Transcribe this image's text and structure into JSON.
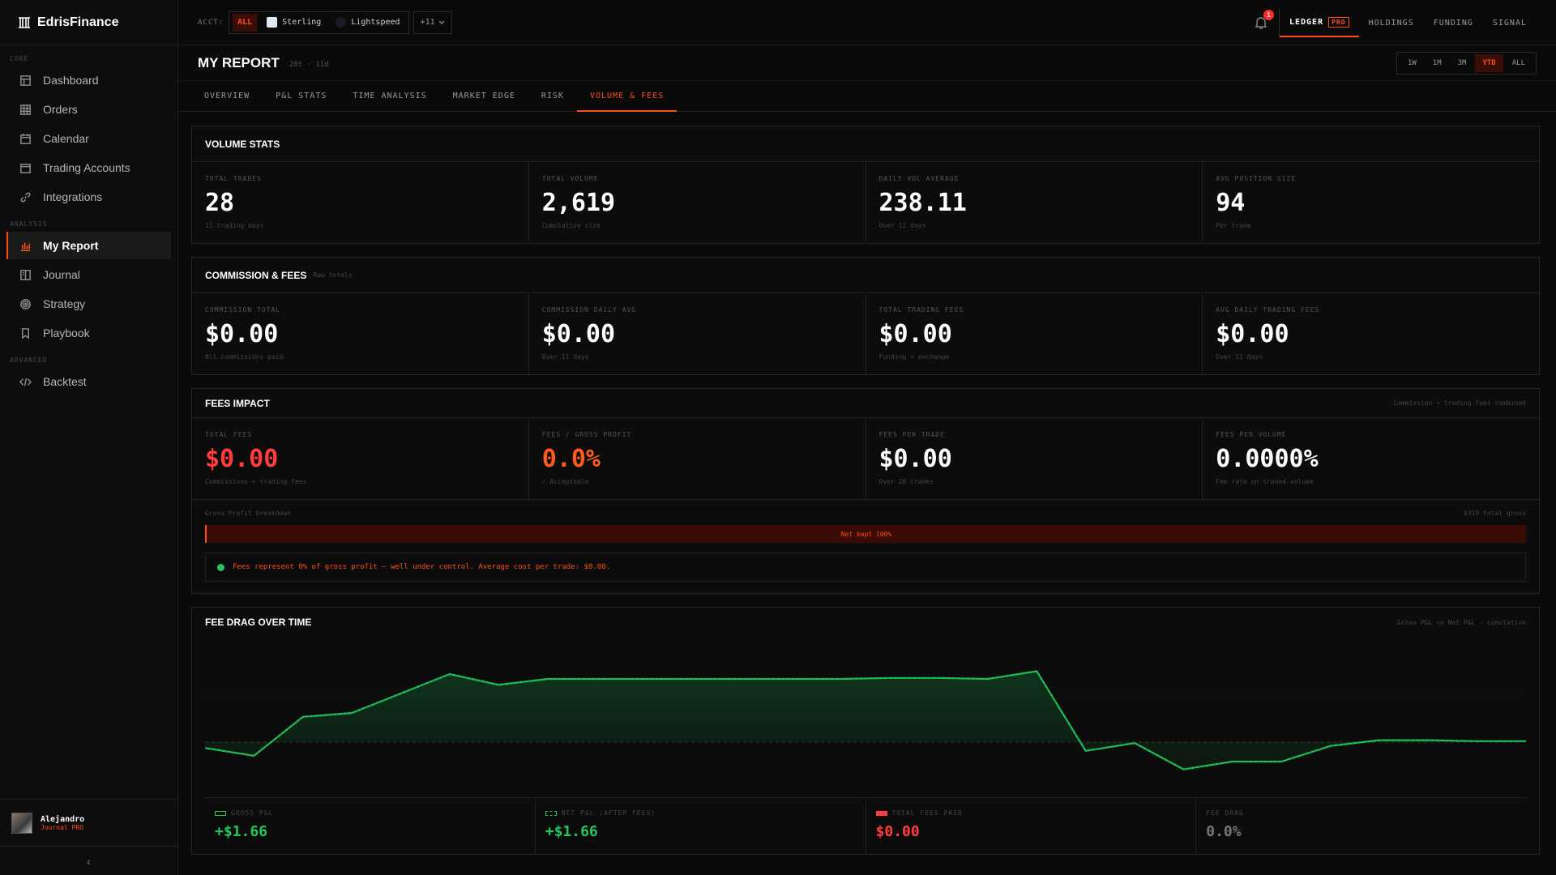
{
  "brand": {
    "name": "EdrisFinance"
  },
  "sidebar": {
    "sections": {
      "core": "CORE",
      "analysis": "ANALYSIS",
      "advanced": "ADVANCED"
    },
    "items": [
      {
        "label": "Dashboard",
        "icon": "layout-icon"
      },
      {
        "label": "Orders",
        "icon": "grid-icon"
      },
      {
        "label": "Calendar",
        "icon": "calendar-icon"
      },
      {
        "label": "Trading Accounts",
        "icon": "wallet-icon"
      },
      {
        "label": "Integrations",
        "icon": "link-icon"
      },
      {
        "label": "My Report",
        "icon": "bar-chart-icon"
      },
      {
        "label": "Journal",
        "icon": "book-icon"
      },
      {
        "label": "Strategy",
        "icon": "target-icon"
      },
      {
        "label": "Playbook",
        "icon": "bookmark-icon"
      },
      {
        "label": "Backtest",
        "icon": "code-icon"
      }
    ],
    "user": {
      "name": "Alejandro",
      "plan": "Journal PRO"
    },
    "collapse": "‹"
  },
  "topbar": {
    "acct_label": "ACCT:",
    "accounts": [
      "ALL",
      "Sterling",
      "Lightspeed"
    ],
    "more": "+11",
    "notifications": "1",
    "tabs": [
      "LEDGER",
      "HOLDINGS",
      "FUNDING",
      "SIGNAL"
    ],
    "pro": "PRO"
  },
  "header": {
    "title": "MY REPORT",
    "meta": "28t · 11d",
    "ranges": [
      "1W",
      "1M",
      "3M",
      "YTD",
      "ALL"
    ]
  },
  "tabs": [
    "OVERVIEW",
    "P&L STATS",
    "TIME ANALYSIS",
    "MARKET EDGE",
    "RISK",
    "VOLUME & FEES"
  ],
  "volume": {
    "title": "VOLUME STATS",
    "stats": [
      {
        "label": "TOTAL TRADES",
        "value": "28",
        "note": "11 trading days"
      },
      {
        "label": "TOTAL VOLUME",
        "value": "2,619",
        "note": "Cumulative size"
      },
      {
        "label": "DAILY VOL AVERAGE",
        "value": "238.11",
        "note": "Over 11 days"
      },
      {
        "label": "AVG POSITION SIZE",
        "value": "94",
        "note": "Per trade"
      }
    ]
  },
  "commission": {
    "title": "COMMISSION & FEES",
    "sub": "Raw totals",
    "stats": [
      {
        "label": "COMMISSION TOTAL",
        "value": "$0.00",
        "note": "All commissions paid"
      },
      {
        "label": "COMMISSION DAILY AVG",
        "value": "$0.00",
        "note": "Over 11 days"
      },
      {
        "label": "TOTAL TRADING FEES",
        "value": "$0.00",
        "note": "Funding + exchange"
      },
      {
        "label": "AVG DAILY TRADING FEES",
        "value": "$0.00",
        "note": "Over 11 days"
      }
    ]
  },
  "impact": {
    "title": "FEES IMPACT",
    "right": "Commission + trading fees combined",
    "stats": [
      {
        "label": "TOTAL FEES",
        "value": "$0.00",
        "note": "Commissions + trading fees"
      },
      {
        "label": "FEES / GROSS PROFIT",
        "value": "0.0%",
        "note": "✓ Acceptable"
      },
      {
        "label": "FEES PER TRADE",
        "value": "$0.00",
        "note": "Over 28 trades"
      },
      {
        "label": "FEES PER VOLUME",
        "value": "0.0000%",
        "note": "Fee rate on traded volume"
      }
    ],
    "breakdown_label": "Gross Profit breakdown",
    "breakdown_total": "$319 total gross",
    "bar_label": "Net kept 100%",
    "net_kept_fraction": 1.0,
    "note": "Fees represent 0% of gross profit — well under control. Average cost per trade: $0.00."
  },
  "drag": {
    "title": "FEE DRAG OVER TIME",
    "right": "Gross P&L vs Net P&L · cumulative",
    "legend": [
      {
        "label": "GROSS P&L",
        "value": "+$1.66"
      },
      {
        "label": "NET P&L (AFTER FEES)",
        "value": "+$1.66"
      },
      {
        "label": "TOTAL FEES PAID",
        "value": "$0.00"
      },
      {
        "label": "FEE DRAG",
        "value": "0.0%"
      }
    ]
  },
  "colors": {
    "accent": "#ff4d1a",
    "positive": "#22c55e",
    "negative": "#ff3b3b"
  },
  "chart_data": {
    "type": "area",
    "title": "FEE DRAG OVER TIME",
    "series": [
      {
        "name": "Gross P&L",
        "values": [
          -0.6,
          -1.4,
          2.6,
          3.0,
          5.0,
          7.0,
          5.9,
          6.5,
          6.5,
          6.5,
          6.5,
          6.5,
          6.5,
          6.5,
          6.6,
          6.6,
          6.5,
          7.3,
          -0.9,
          -0.1,
          -2.8,
          -2.0,
          -2.0,
          -0.4,
          0.2,
          0.2,
          0.1,
          0.1
        ]
      },
      {
        "name": "Net P&L (after fees)",
        "values": [
          -0.6,
          -1.4,
          2.6,
          3.0,
          5.0,
          7.0,
          5.9,
          6.5,
          6.5,
          6.5,
          6.5,
          6.5,
          6.5,
          6.5,
          6.6,
          6.6,
          6.5,
          7.3,
          -0.9,
          -0.1,
          -2.8,
          -2.0,
          -2.0,
          -0.4,
          0.2,
          0.2,
          0.1,
          0.1
        ]
      }
    ],
    "ylim": [
      -5,
      10
    ],
    "grid": true,
    "baseline": 0
  }
}
